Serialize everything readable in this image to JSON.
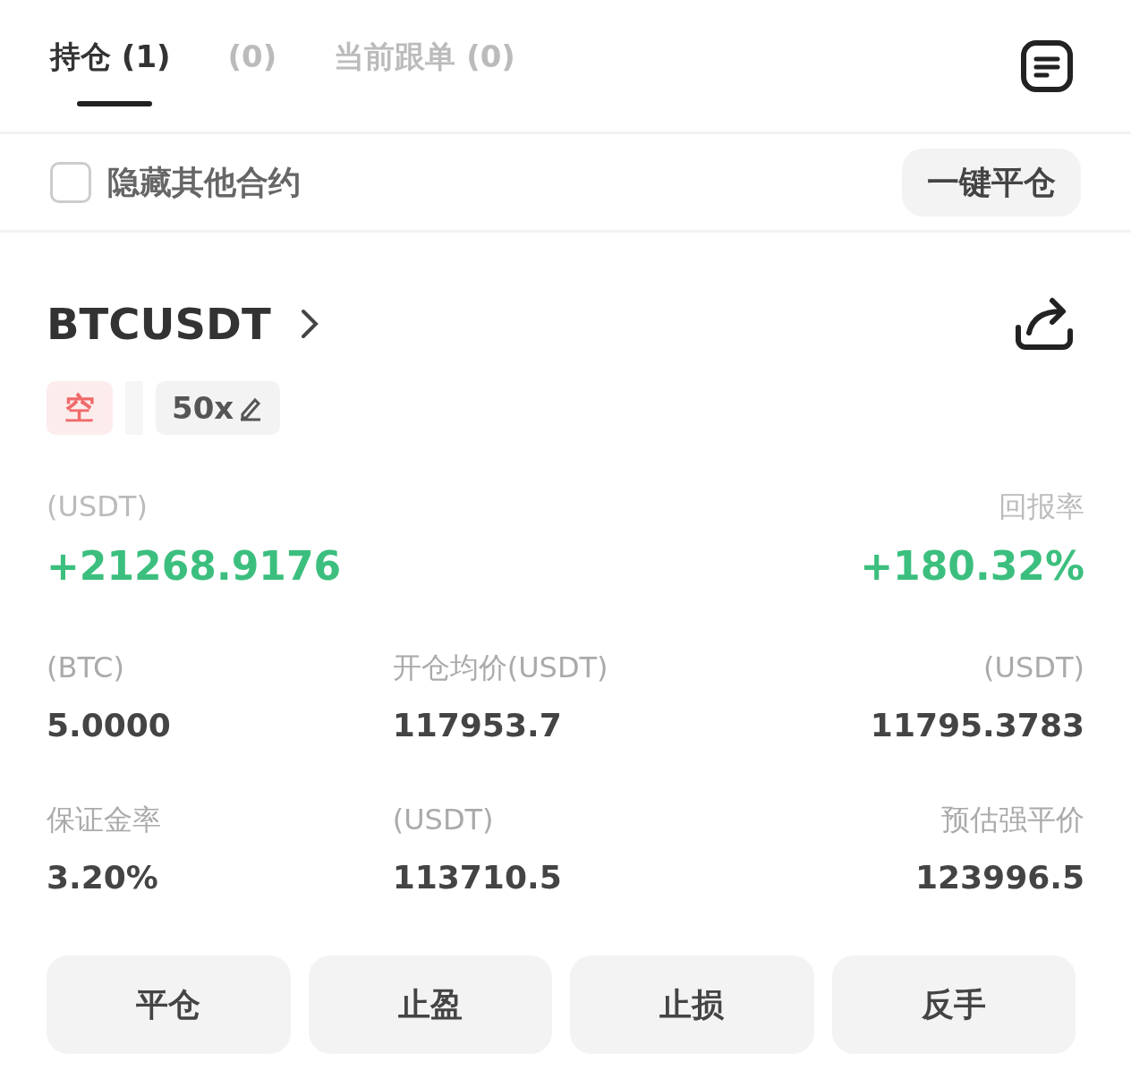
{
  "tabs": [
    {
      "label": "持仓 (1)",
      "selected": true
    },
    {
      "label": "(0)",
      "selected": false
    },
    {
      "label": "当前跟单 (0)",
      "selected": false
    }
  ],
  "filter": {
    "label": "隐藏其他合约",
    "checked": false
  },
  "close_all_button": "一键平仓",
  "position": {
    "symbol": "BTCUSDT",
    "side": "空",
    "leverage": "50x",
    "pnl": {
      "label": "(USDT)",
      "value": "+21268.9176"
    },
    "roi": {
      "label": "回报率",
      "value": "+180.32%"
    },
    "stats": [
      {
        "label": "(BTC)",
        "value": "5.0000"
      },
      {
        "label": "开仓均价(USDT)",
        "value": "117953.7"
      },
      {
        "label": "(USDT)",
        "value": "11795.3783"
      },
      {
        "label": "保证金率",
        "value": "3.20%"
      },
      {
        "label": "(USDT)",
        "value": "113710.5"
      },
      {
        "label": "预估强平价",
        "value": "123996.5"
      }
    ],
    "actions": [
      "平仓",
      "止盈",
      "止损",
      "反手"
    ]
  }
}
